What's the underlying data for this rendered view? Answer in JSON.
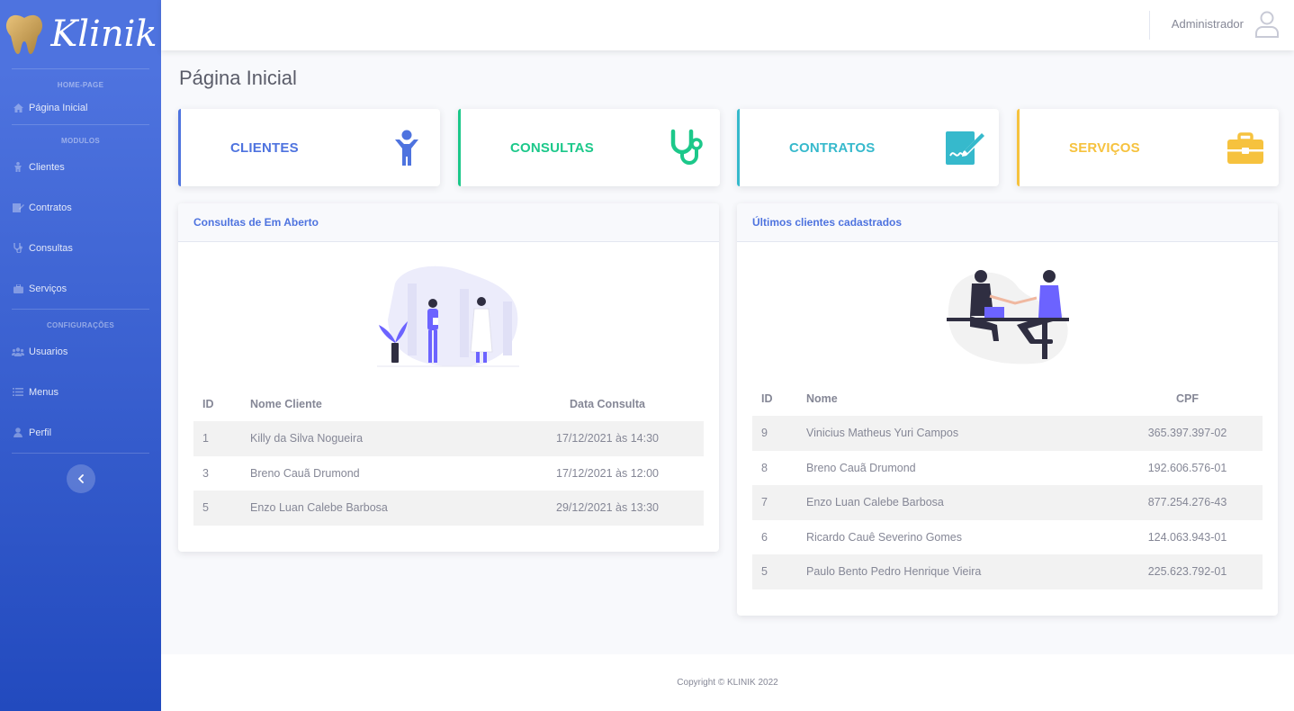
{
  "brand": {
    "name": "Klinik"
  },
  "sidebar": {
    "headings": {
      "home": "HOME-PAGE",
      "modules": "MODULOS",
      "config": "CONFIGURAÇÕES"
    },
    "items": [
      {
        "label": "Página Inicial",
        "icon": "home-icon"
      },
      {
        "label": "Clientes",
        "icon": "child-icon"
      },
      {
        "label": "Contratos",
        "icon": "contract-icon"
      },
      {
        "label": "Consultas",
        "icon": "stethoscope-icon"
      },
      {
        "label": "Serviços",
        "icon": "briefcase-icon"
      },
      {
        "label": "Usuarios",
        "icon": "users-icon"
      },
      {
        "label": "Menus",
        "icon": "list-icon"
      },
      {
        "label": "Perfil",
        "icon": "user-icon"
      }
    ]
  },
  "topbar": {
    "user_name": "Administrador"
  },
  "page": {
    "title": "Página Inicial"
  },
  "cards": [
    {
      "label": "CLIENTES",
      "color": "#4e73df",
      "icon": "child-icon"
    },
    {
      "label": "CONSULTAS",
      "color": "#1cc88a",
      "icon": "stethoscope-icon"
    },
    {
      "label": "CONTRATOS",
      "color": "#36b9cc",
      "icon": "contract-signature-icon"
    },
    {
      "label": "SERVIÇOS",
      "color": "#f6c23e",
      "icon": "briefcase-icon"
    }
  ],
  "consultas_panel": {
    "title": "Consultas de Em Aberto",
    "columns": [
      "ID",
      "Nome Cliente",
      "Data Consulta"
    ],
    "rows": [
      {
        "id": "1",
        "name": "Killy da Silva Nogueira",
        "date": "17/12/2021 às 14:30"
      },
      {
        "id": "3",
        "name": "Breno Cauã Drumond",
        "date": "17/12/2021 às 12:00"
      },
      {
        "id": "5",
        "name": "Enzo Luan Calebe Barbosa",
        "date": "29/12/2021 às 13:30"
      }
    ]
  },
  "clientes_panel": {
    "title": "Últimos clientes cadastrados",
    "columns": [
      "ID",
      "Nome",
      "CPF"
    ],
    "rows": [
      {
        "id": "9",
        "name": "Vinicius Matheus Yuri Campos",
        "cpf": "365.397.397-02"
      },
      {
        "id": "8",
        "name": "Breno Cauã Drumond",
        "cpf": "192.606.576-01"
      },
      {
        "id": "7",
        "name": "Enzo Luan Calebe Barbosa",
        "cpf": "877.254.276-43"
      },
      {
        "id": "6",
        "name": "Ricardo Cauê Severino Gomes",
        "cpf": "124.063.943-01"
      },
      {
        "id": "5",
        "name": "Paulo Bento Pedro Henrique Vieira",
        "cpf": "225.623.792-01"
      }
    ]
  },
  "footer": {
    "text": "Copyright © KLINIK 2022"
  }
}
